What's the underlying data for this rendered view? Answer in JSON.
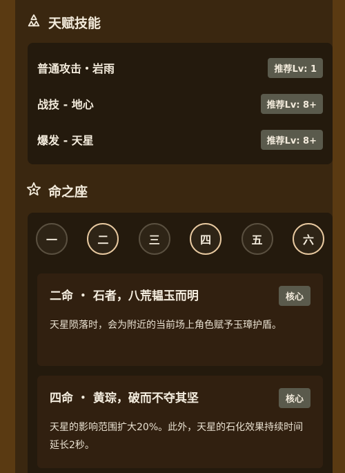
{
  "talents": {
    "title": "天赋技能",
    "skills": [
      {
        "name": "普通攻击・岩雨",
        "recommend": "推荐Lv: 1"
      },
      {
        "name": "战技 - 地心",
        "recommend": "推荐Lv: 8+"
      },
      {
        "name": "爆发 - 天星",
        "recommend": "推荐Lv: 8+"
      }
    ]
  },
  "constellations": {
    "title": "命之座",
    "levels": [
      {
        "label": "一",
        "active": false
      },
      {
        "label": "二",
        "active": true
      },
      {
        "label": "三",
        "active": false
      },
      {
        "label": "四",
        "active": true
      },
      {
        "label": "五",
        "active": false
      },
      {
        "label": "六",
        "active": true
      }
    ],
    "cards": [
      {
        "title": "二命 ・ 石者，八荒韫玉而明",
        "badge": "核心",
        "desc": "天星陨落时，会为附近的当前场上角色赋予玉璋护盾。"
      },
      {
        "title": "四命 ・ 黄琮，破而不夺其坚",
        "badge": "核心",
        "desc": "天星的影响范围扩大20%。此外，天星的石化效果持续时间延长2秒。"
      }
    ]
  },
  "colors": {
    "outer_bg": "#5a3a12",
    "page_bg": "#3a2710",
    "panel_bg": "#241a0d",
    "badge_bg": "#5a5a4c",
    "active_ring": "#e8c9a0"
  },
  "icons": {
    "talents": "recycle-icon",
    "constellations": "star-icon"
  }
}
